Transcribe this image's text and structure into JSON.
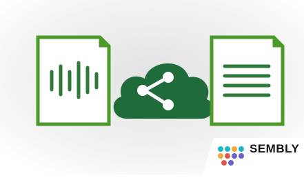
{
  "brand": {
    "name": "SEMBLY",
    "logo_dot_colors": [
      "#1fb7c4",
      "#f2a93b",
      "#e2584c",
      "#6a62c9"
    ]
  },
  "icons": {
    "left": "audio-file-icon",
    "center": "cloud-share-icon",
    "right": "text-document-icon"
  },
  "colors": {
    "green": "#4c9a2a",
    "dark_green": "#1f6b3a",
    "background_gradient_center": "#e6e6e6",
    "background_gradient_edge": "#ffffff"
  }
}
